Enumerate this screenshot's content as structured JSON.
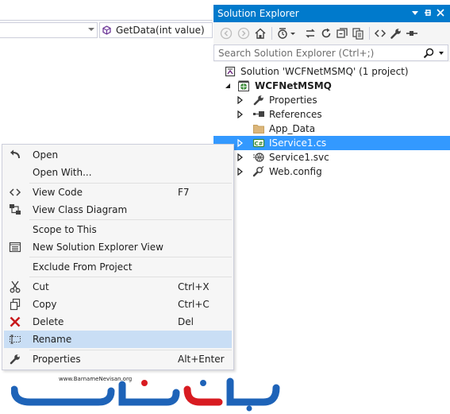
{
  "editor": {
    "method_combo_value": "GetData(int value)"
  },
  "solution_explorer": {
    "title": "Solution Explorer",
    "search_placeholder": "Search Solution Explorer (Ctrl+;)",
    "tree": [
      {
        "label": "Solution 'WCFNetMSMQ' (1 project)",
        "icon": "solution-icon",
        "expander": "none",
        "bold": false,
        "selected": false
      },
      {
        "label": "WCFNetMSMQ",
        "icon": "web-project-icon",
        "expander": "expanded",
        "bold": true,
        "selected": false
      },
      {
        "label": "Properties",
        "icon": "wrench-icon",
        "expander": "collapsed",
        "bold": false,
        "selected": false
      },
      {
        "label": "References",
        "icon": "references-icon",
        "expander": "collapsed",
        "bold": false,
        "selected": false
      },
      {
        "label": "App_Data",
        "icon": "folder-icon",
        "expander": "none",
        "bold": false,
        "selected": false
      },
      {
        "label": "IService1.cs",
        "icon": "csharp-file-icon",
        "expander": "collapsed",
        "bold": false,
        "selected": true
      },
      {
        "label": "Service1.svc",
        "icon": "svc-file-icon",
        "expander": "collapsed",
        "bold": false,
        "selected": false
      },
      {
        "label": "Web.config",
        "icon": "config-file-icon",
        "expander": "collapsed",
        "bold": false,
        "selected": false
      }
    ],
    "colors": {
      "title_bar": "#007acc",
      "selection": "#3399ff"
    }
  },
  "context_menu": {
    "items": [
      {
        "label": "Open",
        "shortcut": "",
        "icon": "open-icon"
      },
      {
        "label": "Open With...",
        "shortcut": "",
        "icon": ""
      },
      {
        "label": "View Code",
        "shortcut": "F7",
        "icon": "code-icon"
      },
      {
        "label": "View Class Diagram",
        "shortcut": "",
        "icon": "class-diagram-icon"
      },
      {
        "label": "Scope to This",
        "shortcut": "",
        "icon": ""
      },
      {
        "label": "New Solution Explorer View",
        "shortcut": "",
        "icon": "new-view-icon"
      },
      {
        "label": "Exclude From Project",
        "shortcut": "",
        "icon": ""
      },
      {
        "label": "Cut",
        "shortcut": "Ctrl+X",
        "icon": "scissors-icon"
      },
      {
        "label": "Copy",
        "shortcut": "Ctrl+C",
        "icon": "copy-icon"
      },
      {
        "label": "Delete",
        "shortcut": "Del",
        "icon": "delete-icon"
      },
      {
        "label": "Rename",
        "shortcut": "",
        "icon": "rename-icon"
      },
      {
        "label": "Properties",
        "shortcut": "Alt+Enter",
        "icon": "wrench-icon"
      }
    ],
    "highlighted": "Rename",
    "colors": {
      "highlight": "#c9def5",
      "delete_icon": "#c8191c"
    }
  },
  "watermark": {
    "site": "www.BarnameNevisan.org",
    "colors": {
      "primary": "#1e63b8",
      "accent": "#d81b21"
    }
  }
}
